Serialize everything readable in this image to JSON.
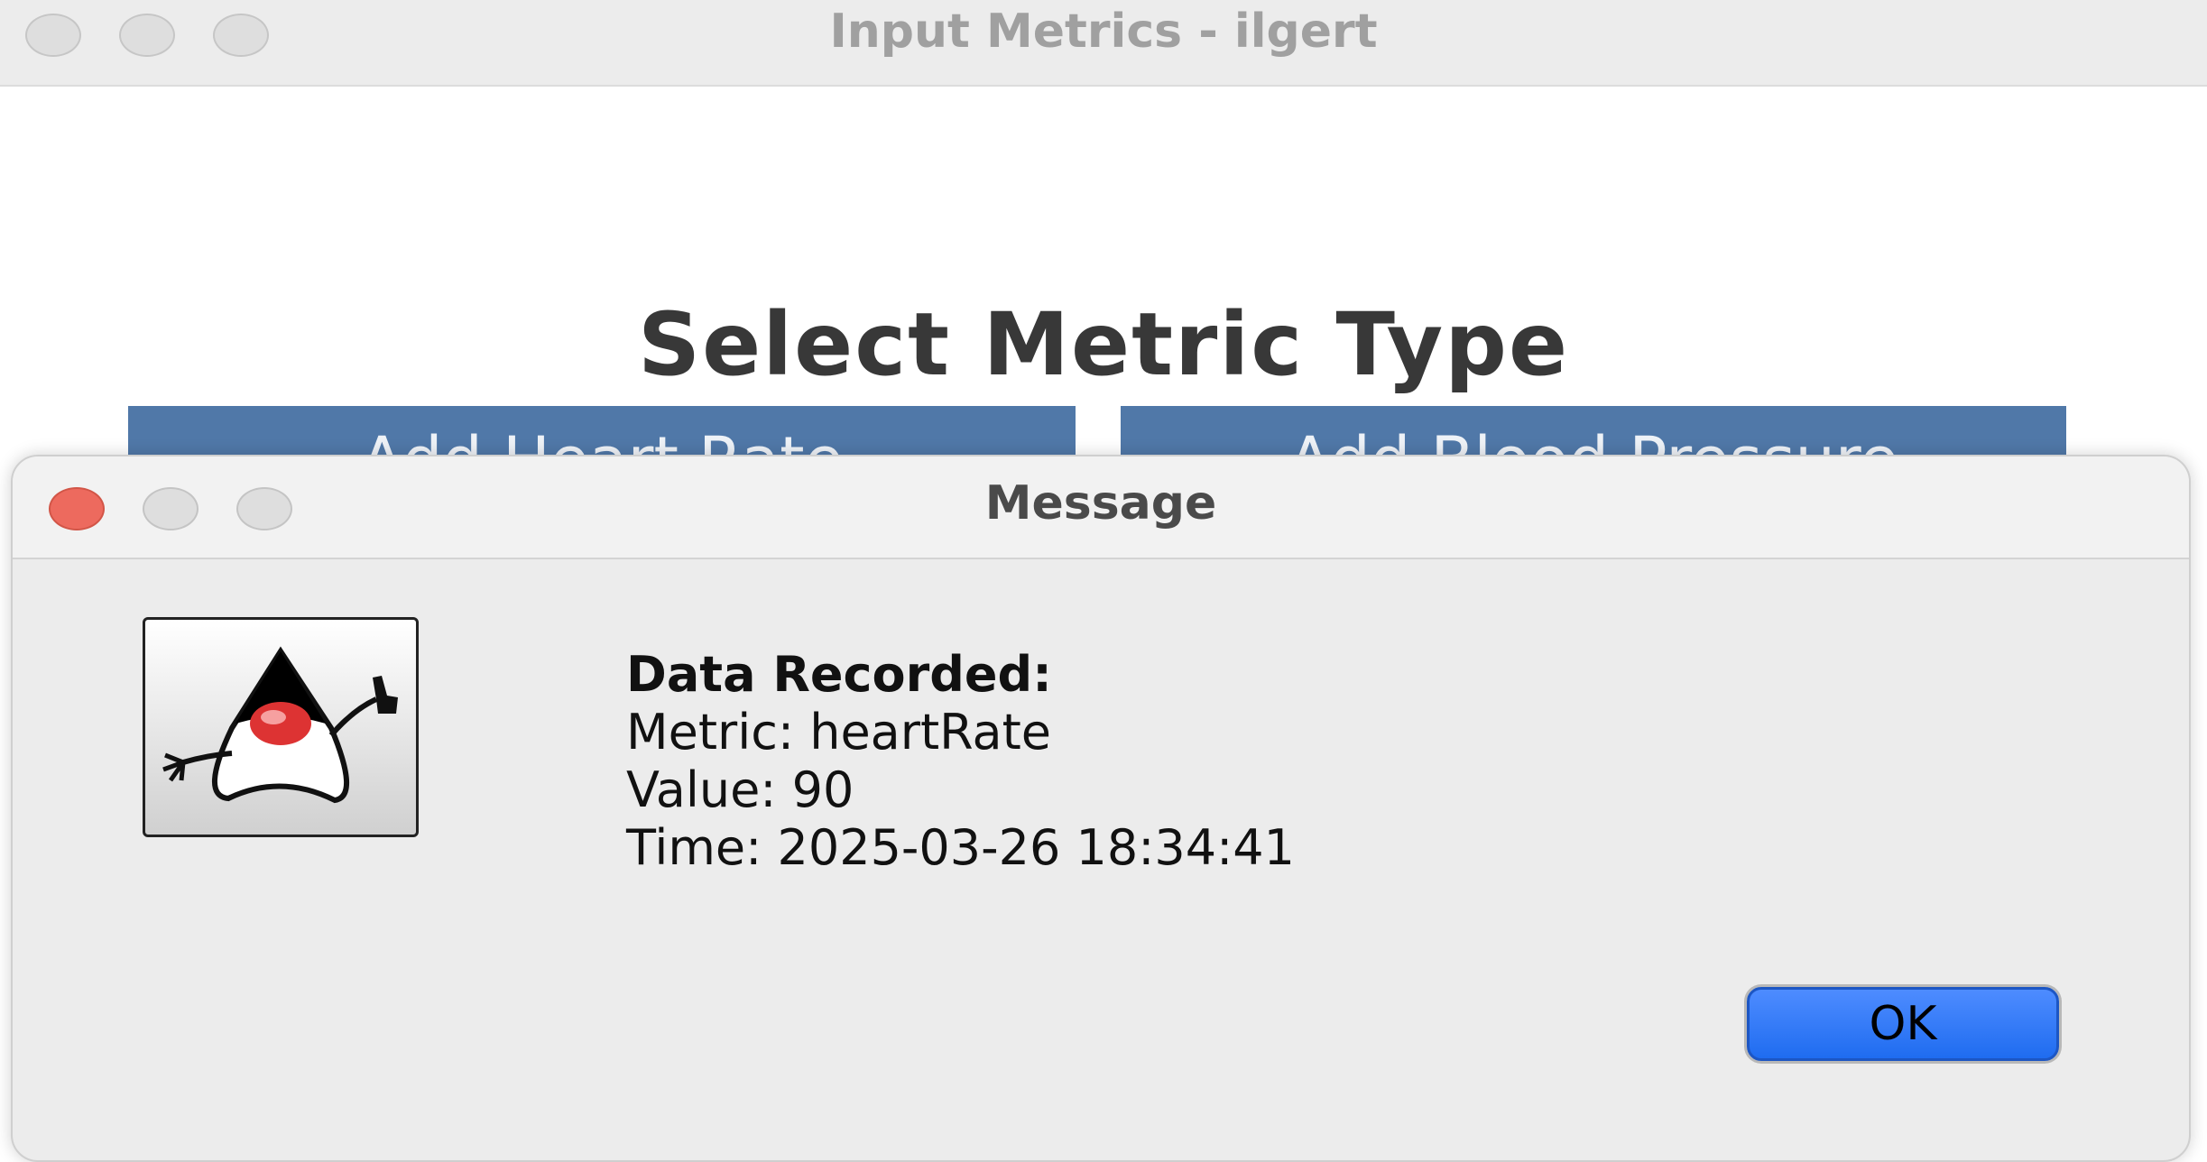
{
  "main_window": {
    "title": "Input Metrics - ilgert",
    "heading": "Select Metric Type",
    "buttons": {
      "heart_rate": "Add Heart Rate",
      "blood_pressure": "Add Blood Pressure"
    }
  },
  "dialog": {
    "title": "Message",
    "message": {
      "header": "Data Recorded:",
      "metric_line": "Metric: heartRate",
      "value_line": "Value: 90",
      "time_line": "Time: 2025-03-26 18:34:41"
    },
    "ok_label": "OK",
    "icon": "java-duke-icon"
  },
  "colors": {
    "close_red": "#ed6a5e",
    "button_blue": "#5078a8",
    "ok_blue": "#2f78f5"
  }
}
